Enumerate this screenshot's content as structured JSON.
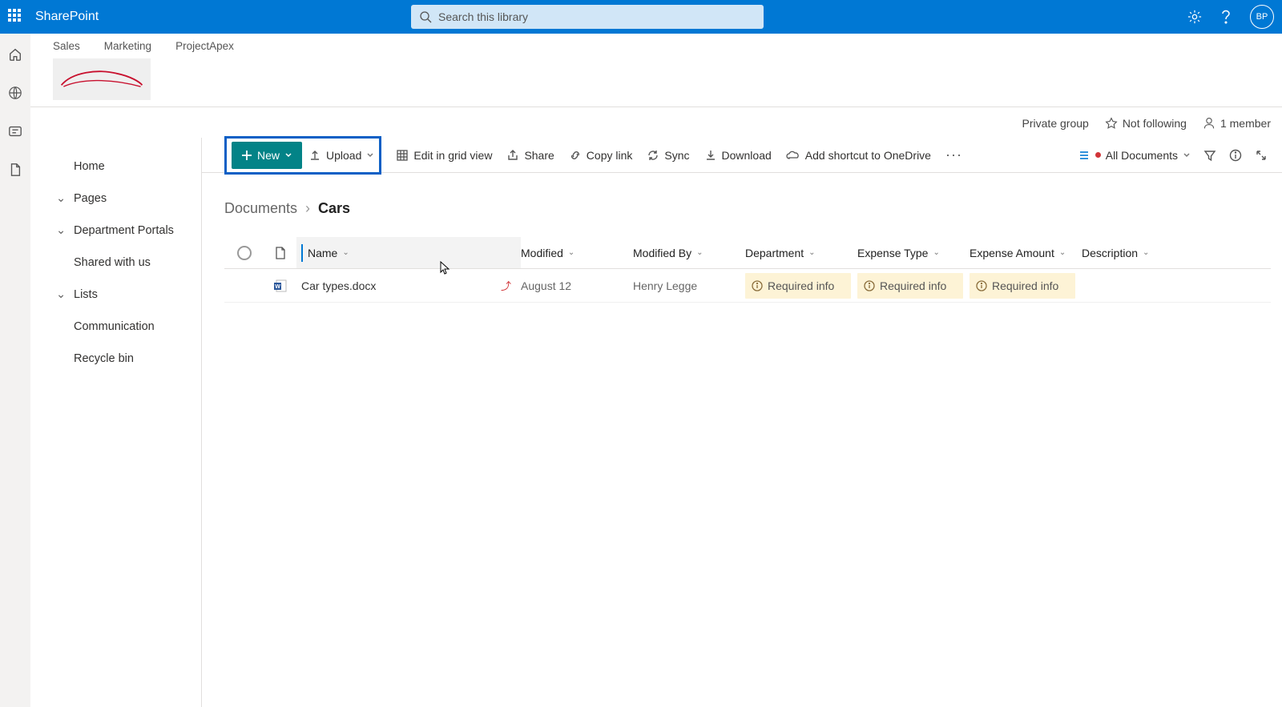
{
  "brand": "SharePoint",
  "search": {
    "placeholder": "Search this library"
  },
  "avatar_initials": "BP",
  "hub_tabs": [
    "Sales",
    "Marketing",
    "ProjectApex"
  ],
  "group_info": {
    "privacy": "Private group",
    "follow": "Not following",
    "members": "1 member"
  },
  "site_nav": {
    "home": "Home",
    "pages": "Pages",
    "dept": "Department Portals",
    "shared": "Shared with us",
    "lists": "Lists",
    "comm": "Communication",
    "recycle": "Recycle bin"
  },
  "commands": {
    "new": "New",
    "upload": "Upload",
    "edit_grid": "Edit in grid view",
    "share": "Share",
    "copy_link": "Copy link",
    "sync": "Sync",
    "download": "Download",
    "add_shortcut": "Add shortcut to OneDrive",
    "view_name": "All Documents"
  },
  "breadcrumb": {
    "root": "Documents",
    "current": "Cars"
  },
  "columns": {
    "name": "Name",
    "modified": "Modified",
    "modified_by": "Modified By",
    "department": "Department",
    "expense_type": "Expense Type",
    "expense_amount": "Expense Amount",
    "description": "Description"
  },
  "rows": [
    {
      "filename": "Car types.docx",
      "modified": "August 12",
      "modified_by": "Henry Legge",
      "department": "Required info",
      "expense_type": "Required info",
      "expense_amount": "Required info"
    }
  ]
}
